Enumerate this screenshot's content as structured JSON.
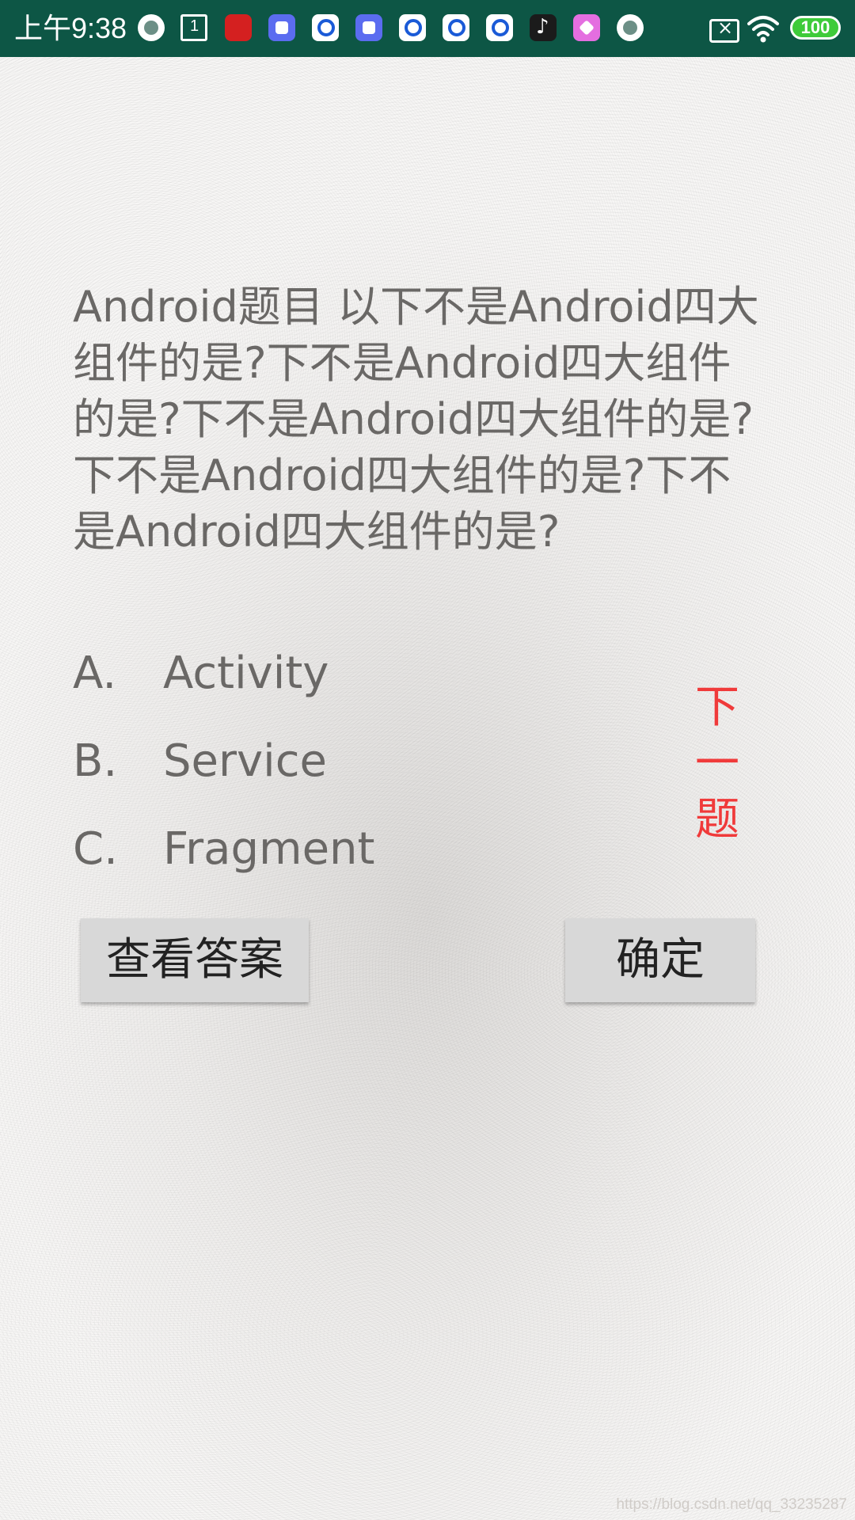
{
  "status_bar": {
    "time": "上午9:38",
    "notification_icons": [
      "ring-icon",
      "calendar-icon",
      "xuexi-app-icon",
      "blue-app-icon",
      "qq-icon",
      "blue-app-icon",
      "qq-icon",
      "qq-icon",
      "qq-icon",
      "tiktok-icon",
      "pink-app-icon",
      "ring-icon"
    ],
    "battery_level": "100",
    "colors": {
      "background": "#0d5645",
      "battery": "#3ecb3a"
    }
  },
  "quiz": {
    "question": "Android题目  以下不是Android四大组件的是?下不是Android四大组件的是?下不是Android四大组件的是?下不是Android四大组件的是?下不是Android四大组件的是?",
    "options": [
      {
        "letter": "A.",
        "text": "Activity"
      },
      {
        "letter": "B.",
        "text": "Service"
      },
      {
        "letter": "C.",
        "text": "Fragment"
      }
    ],
    "next_label": "下一题",
    "view_answer_label": "查看答案",
    "confirm_label": "确定",
    "colors": {
      "text": "#6a6866",
      "next": "#f03a3a",
      "button_bg": "#d8d8d8"
    }
  },
  "watermark": "https://blog.csdn.net/qq_33235287"
}
